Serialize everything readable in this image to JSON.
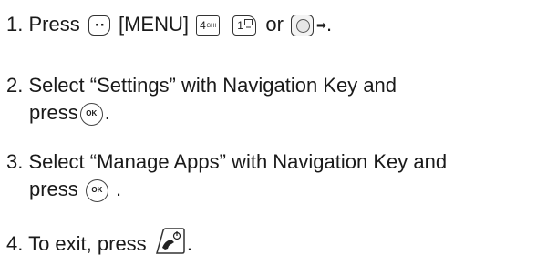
{
  "steps": [
    {
      "number": "1.",
      "text_before": "Press",
      "menu_label": "[MENU]",
      "key4_number": "4",
      "key4_letters": "GHI",
      "key1_number": "1",
      "or_word": "or",
      "end_punct": "."
    },
    {
      "number": "2.",
      "line1": "Select “Settings” with Navigation Key and",
      "line2": "press",
      "ok_key": "OK",
      "end_punct": "."
    },
    {
      "number": "3.",
      "line1": "Select “Manage Apps” with Navigation Key and",
      "line2": "press",
      "ok_key": "OK",
      "end_punct": "."
    },
    {
      "number": "4.",
      "text": "To exit, press",
      "end_punct": "."
    }
  ],
  "icons": {
    "menu_key": "menu-key-icon",
    "num4_key": "number-4-key-icon",
    "num1_key": "number-1-voicemail-key-icon",
    "nav_key": "navigation-key-icon",
    "arrow": "right-arrow-icon",
    "ok_key": "ok-key-icon",
    "end_key": "end-power-key-icon"
  }
}
